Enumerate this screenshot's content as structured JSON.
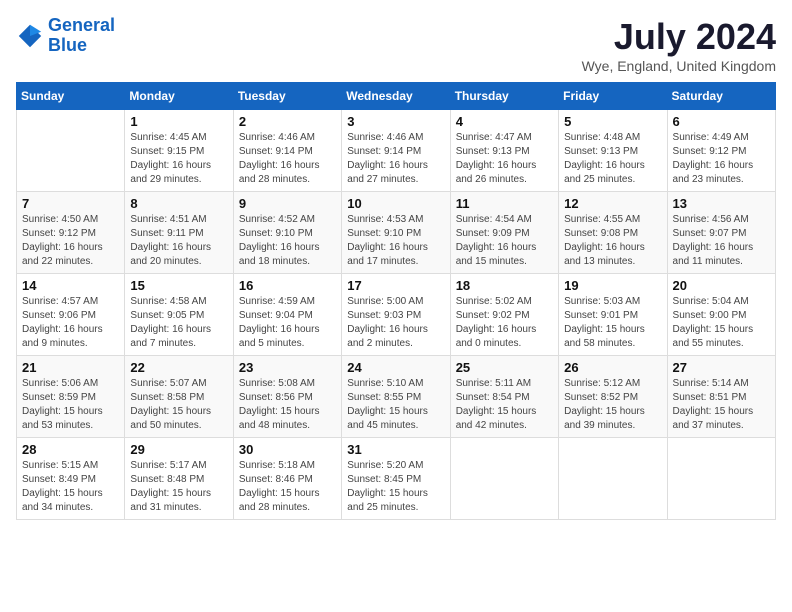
{
  "header": {
    "logo_general": "General",
    "logo_blue": "Blue",
    "month_title": "July 2024",
    "location": "Wye, England, United Kingdom"
  },
  "days_of_week": [
    "Sunday",
    "Monday",
    "Tuesday",
    "Wednesday",
    "Thursday",
    "Friday",
    "Saturday"
  ],
  "weeks": [
    [
      {
        "day": "",
        "info": ""
      },
      {
        "day": "1",
        "info": "Sunrise: 4:45 AM\nSunset: 9:15 PM\nDaylight: 16 hours\nand 29 minutes."
      },
      {
        "day": "2",
        "info": "Sunrise: 4:46 AM\nSunset: 9:14 PM\nDaylight: 16 hours\nand 28 minutes."
      },
      {
        "day": "3",
        "info": "Sunrise: 4:46 AM\nSunset: 9:14 PM\nDaylight: 16 hours\nand 27 minutes."
      },
      {
        "day": "4",
        "info": "Sunrise: 4:47 AM\nSunset: 9:13 PM\nDaylight: 16 hours\nand 26 minutes."
      },
      {
        "day": "5",
        "info": "Sunrise: 4:48 AM\nSunset: 9:13 PM\nDaylight: 16 hours\nand 25 minutes."
      },
      {
        "day": "6",
        "info": "Sunrise: 4:49 AM\nSunset: 9:12 PM\nDaylight: 16 hours\nand 23 minutes."
      }
    ],
    [
      {
        "day": "7",
        "info": "Sunrise: 4:50 AM\nSunset: 9:12 PM\nDaylight: 16 hours\nand 22 minutes."
      },
      {
        "day": "8",
        "info": "Sunrise: 4:51 AM\nSunset: 9:11 PM\nDaylight: 16 hours\nand 20 minutes."
      },
      {
        "day": "9",
        "info": "Sunrise: 4:52 AM\nSunset: 9:10 PM\nDaylight: 16 hours\nand 18 minutes."
      },
      {
        "day": "10",
        "info": "Sunrise: 4:53 AM\nSunset: 9:10 PM\nDaylight: 16 hours\nand 17 minutes."
      },
      {
        "day": "11",
        "info": "Sunrise: 4:54 AM\nSunset: 9:09 PM\nDaylight: 16 hours\nand 15 minutes."
      },
      {
        "day": "12",
        "info": "Sunrise: 4:55 AM\nSunset: 9:08 PM\nDaylight: 16 hours\nand 13 minutes."
      },
      {
        "day": "13",
        "info": "Sunrise: 4:56 AM\nSunset: 9:07 PM\nDaylight: 16 hours\nand 11 minutes."
      }
    ],
    [
      {
        "day": "14",
        "info": "Sunrise: 4:57 AM\nSunset: 9:06 PM\nDaylight: 16 hours\nand 9 minutes."
      },
      {
        "day": "15",
        "info": "Sunrise: 4:58 AM\nSunset: 9:05 PM\nDaylight: 16 hours\nand 7 minutes."
      },
      {
        "day": "16",
        "info": "Sunrise: 4:59 AM\nSunset: 9:04 PM\nDaylight: 16 hours\nand 5 minutes."
      },
      {
        "day": "17",
        "info": "Sunrise: 5:00 AM\nSunset: 9:03 PM\nDaylight: 16 hours\nand 2 minutes."
      },
      {
        "day": "18",
        "info": "Sunrise: 5:02 AM\nSunset: 9:02 PM\nDaylight: 16 hours\nand 0 minutes."
      },
      {
        "day": "19",
        "info": "Sunrise: 5:03 AM\nSunset: 9:01 PM\nDaylight: 15 hours\nand 58 minutes."
      },
      {
        "day": "20",
        "info": "Sunrise: 5:04 AM\nSunset: 9:00 PM\nDaylight: 15 hours\nand 55 minutes."
      }
    ],
    [
      {
        "day": "21",
        "info": "Sunrise: 5:06 AM\nSunset: 8:59 PM\nDaylight: 15 hours\nand 53 minutes."
      },
      {
        "day": "22",
        "info": "Sunrise: 5:07 AM\nSunset: 8:58 PM\nDaylight: 15 hours\nand 50 minutes."
      },
      {
        "day": "23",
        "info": "Sunrise: 5:08 AM\nSunset: 8:56 PM\nDaylight: 15 hours\nand 48 minutes."
      },
      {
        "day": "24",
        "info": "Sunrise: 5:10 AM\nSunset: 8:55 PM\nDaylight: 15 hours\nand 45 minutes."
      },
      {
        "day": "25",
        "info": "Sunrise: 5:11 AM\nSunset: 8:54 PM\nDaylight: 15 hours\nand 42 minutes."
      },
      {
        "day": "26",
        "info": "Sunrise: 5:12 AM\nSunset: 8:52 PM\nDaylight: 15 hours\nand 39 minutes."
      },
      {
        "day": "27",
        "info": "Sunrise: 5:14 AM\nSunset: 8:51 PM\nDaylight: 15 hours\nand 37 minutes."
      }
    ],
    [
      {
        "day": "28",
        "info": "Sunrise: 5:15 AM\nSunset: 8:49 PM\nDaylight: 15 hours\nand 34 minutes."
      },
      {
        "day": "29",
        "info": "Sunrise: 5:17 AM\nSunset: 8:48 PM\nDaylight: 15 hours\nand 31 minutes."
      },
      {
        "day": "30",
        "info": "Sunrise: 5:18 AM\nSunset: 8:46 PM\nDaylight: 15 hours\nand 28 minutes."
      },
      {
        "day": "31",
        "info": "Sunrise: 5:20 AM\nSunset: 8:45 PM\nDaylight: 15 hours\nand 25 minutes."
      },
      {
        "day": "",
        "info": ""
      },
      {
        "day": "",
        "info": ""
      },
      {
        "day": "",
        "info": ""
      }
    ]
  ]
}
